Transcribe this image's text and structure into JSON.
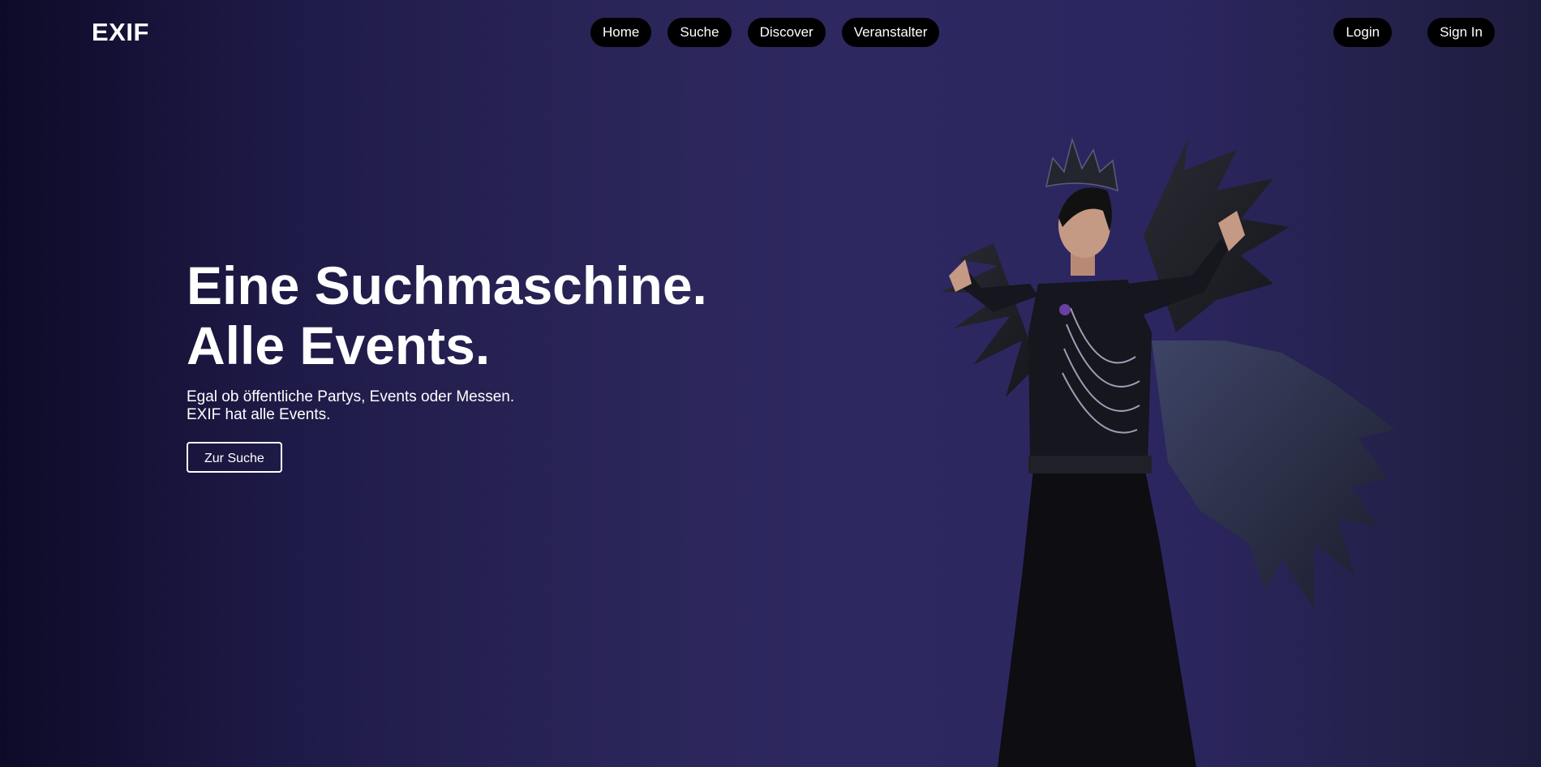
{
  "header": {
    "logo": "EXIF",
    "nav": [
      "Home",
      "Suche",
      "Discover",
      "Veranstalter"
    ],
    "auth": [
      "Login",
      "Sign In"
    ]
  },
  "hero": {
    "headline_line1": "Eine Suchmaschine.",
    "headline_line2": "Alle Events.",
    "subtitle_line1": "Egal ob öffentliche Partys, Events oder Messen.",
    "subtitle_line2": "EXIF hat alle Events.",
    "cta": "Zur Suche"
  },
  "colors": {
    "background_dark": "#0d0a28",
    "background_mid": "#2e2861",
    "pill": "#000000",
    "text": "#ffffff"
  }
}
